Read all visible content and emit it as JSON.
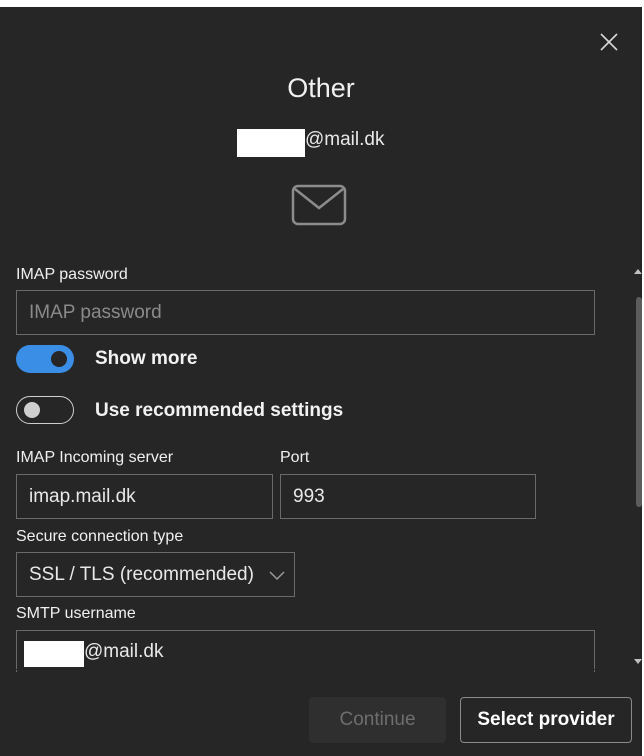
{
  "dialog": {
    "title": "Other",
    "email_suffix": "@mail.dk",
    "icons": {
      "close": "close-icon",
      "envelope": "envelope-icon",
      "chevron": "chevron-down-icon"
    }
  },
  "imap_password": {
    "label": "IMAP password",
    "placeholder": "IMAP password",
    "value": ""
  },
  "show_more": {
    "label": "Show more",
    "state": "on"
  },
  "recommended": {
    "label": "Use recommended settings",
    "state": "off"
  },
  "incoming": {
    "label": "IMAP Incoming server",
    "value": "imap.mail.dk",
    "port_label": "Port",
    "port_value": "993"
  },
  "secure": {
    "label": "Secure connection type",
    "value": "SSL / TLS (recommended)"
  },
  "smtp_username": {
    "label": "SMTP username",
    "value_suffix": "@mail.dk"
  },
  "footer": {
    "continue_label": "Continue",
    "provider_label": "Select provider"
  },
  "colors": {
    "background": "#262626",
    "accent": "#3a8ee6",
    "text": "#f2f2f2"
  }
}
